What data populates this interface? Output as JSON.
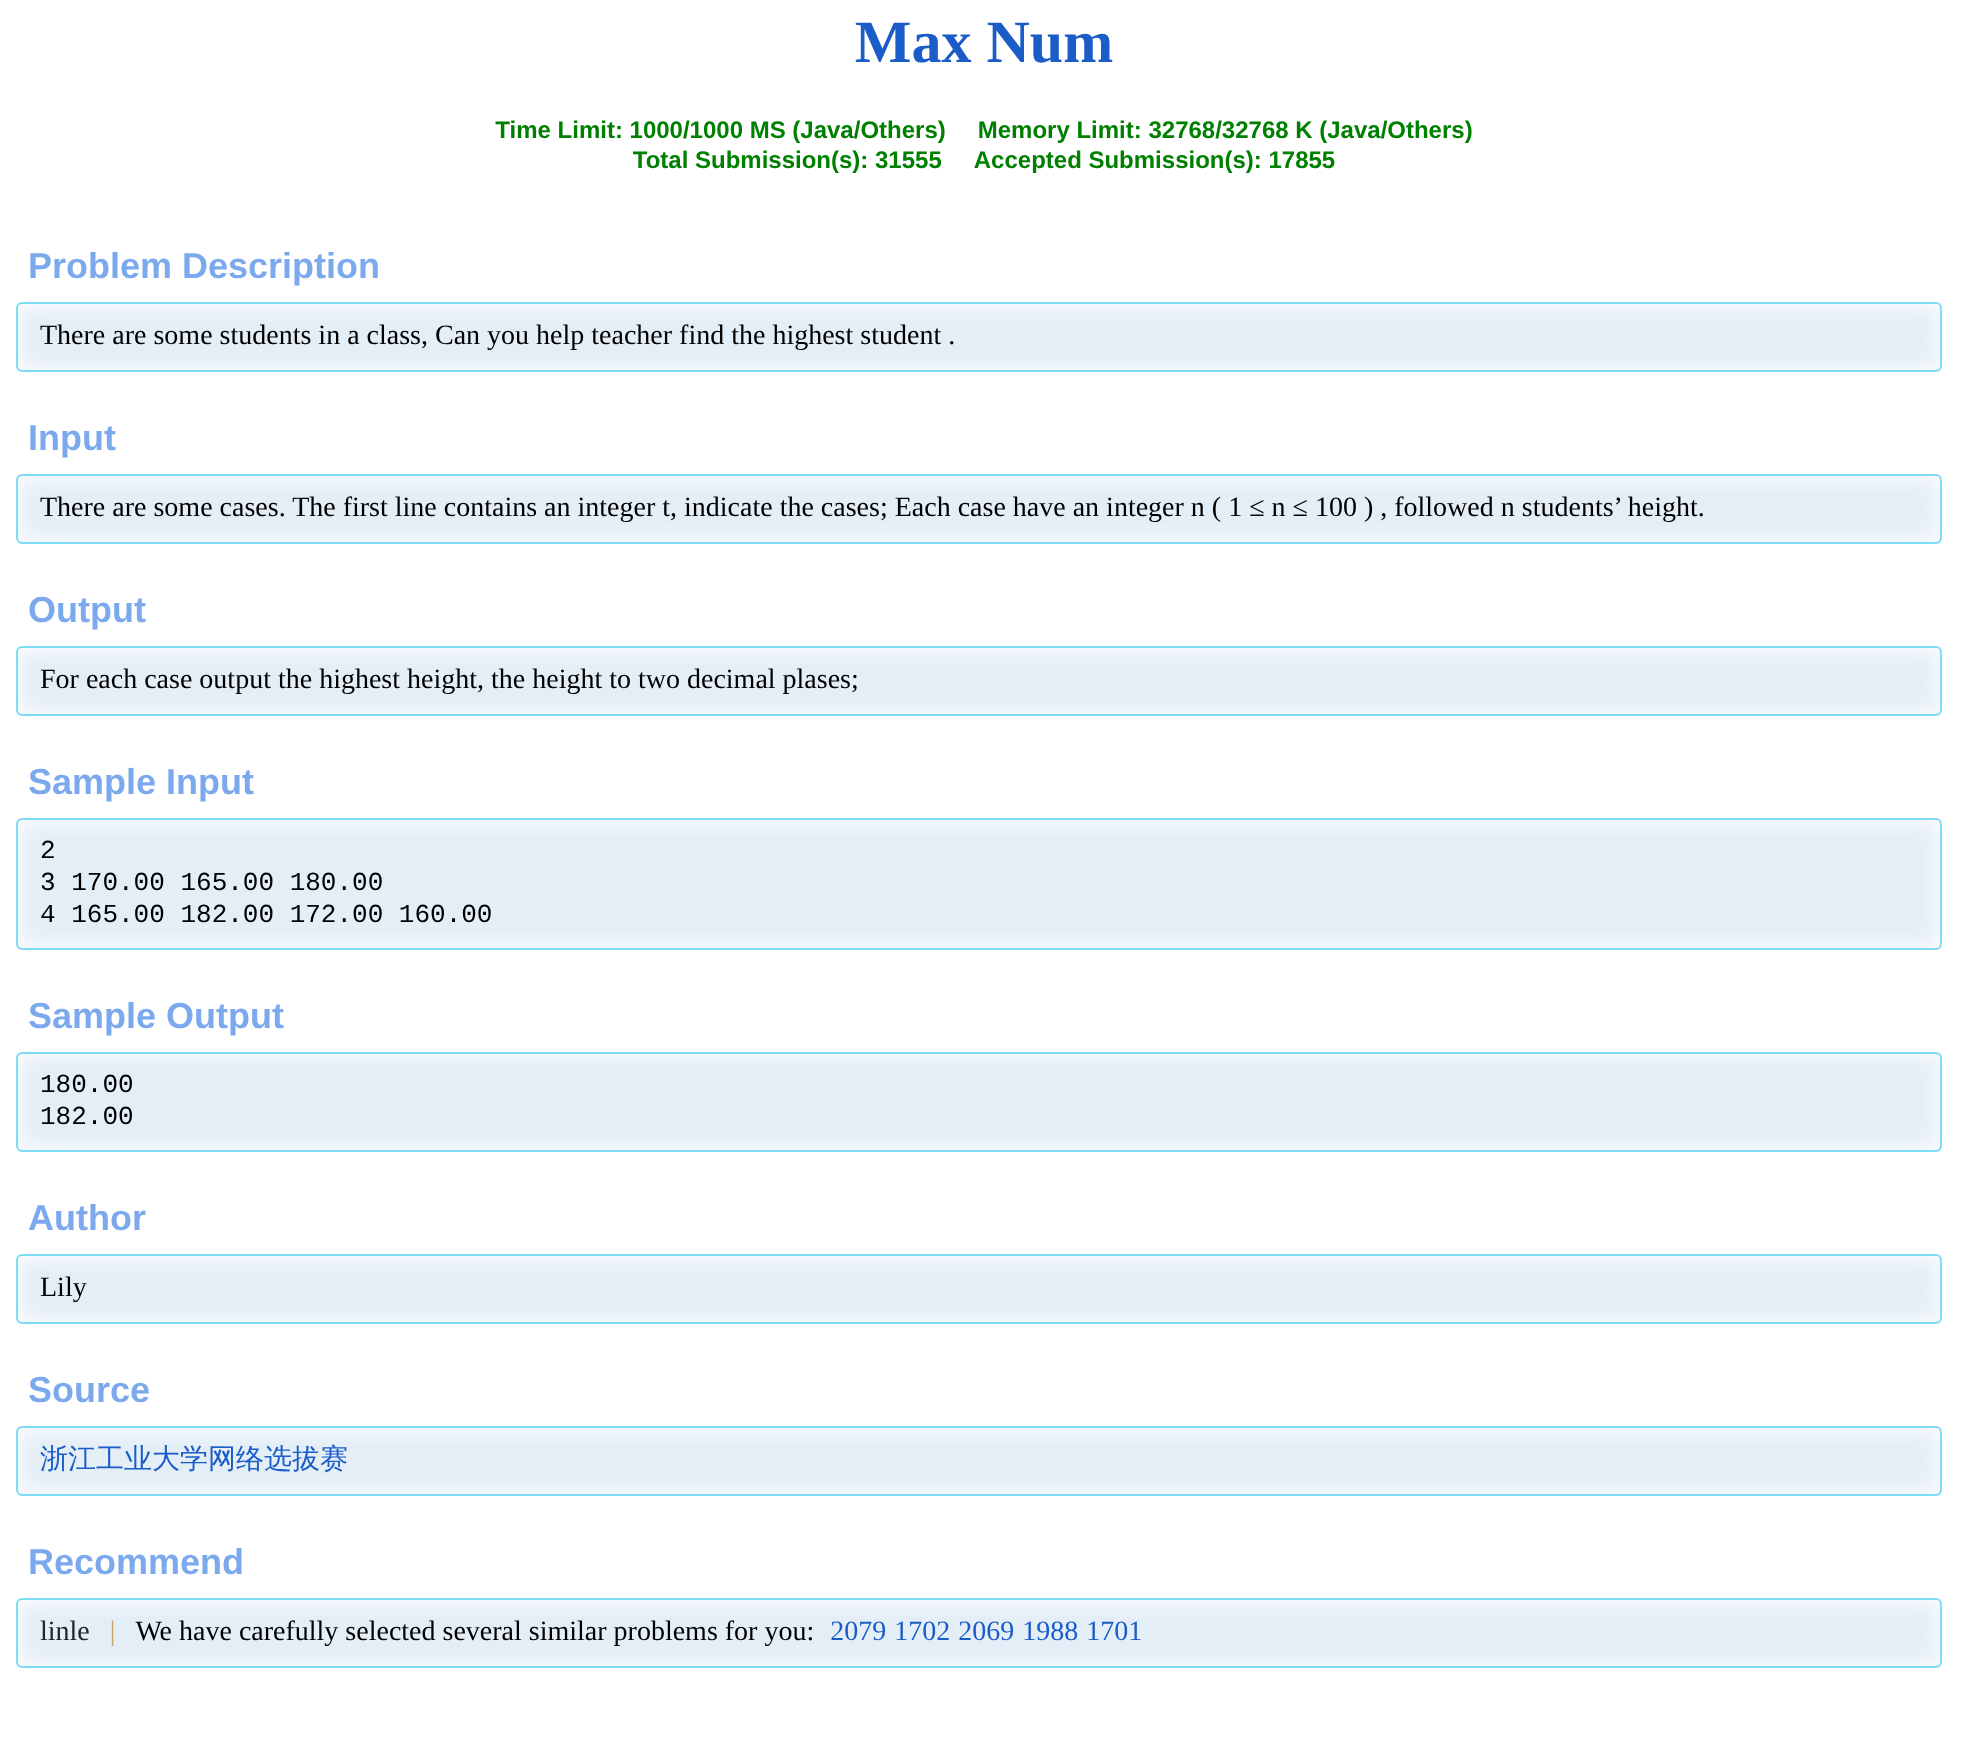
{
  "title": "Max Num",
  "limits": [
    "Time Limit: 1000/1000 MS (Java/Others)",
    "Memory Limit: 32768/32768 K (Java/Others)"
  ],
  "submissions": [
    "Total Submission(s): 31555",
    "Accepted Submission(s): 17855"
  ],
  "sections": [
    {
      "heading": "Problem Description",
      "kind": "text",
      "text": "There are some students in a class, Can you help teacher find the highest student ."
    },
    {
      "heading": "Input",
      "kind": "text",
      "text": "There are some cases. The first line contains an integer t, indicate the cases; Each case have an integer n ( 1 ≤ n ≤ 100 ) , followed n students’ height."
    },
    {
      "heading": "Output",
      "kind": "text",
      "text": "For each case output the highest height, the height to two decimal plases;"
    },
    {
      "heading": "Sample Input",
      "kind": "code",
      "lines": [
        "2",
        "3 170.00 165.00 180.00",
        "4 165.00 182.00 172.00 160.00"
      ]
    },
    {
      "heading": "Sample Output",
      "kind": "code",
      "lines": [
        "180.00",
        "182.00"
      ]
    },
    {
      "heading": "Author",
      "kind": "text",
      "text": "Lily"
    },
    {
      "heading": "Source",
      "kind": "link",
      "text": "浙江工业大学网络选拔赛"
    },
    {
      "heading": "Recommend",
      "kind": "recommend",
      "user": "linle",
      "separator": "|",
      "text": "We have carefully selected several similar problems for you:",
      "problems": [
        "2079",
        "1702",
        "2069",
        "1988",
        "1701"
      ]
    }
  ]
}
